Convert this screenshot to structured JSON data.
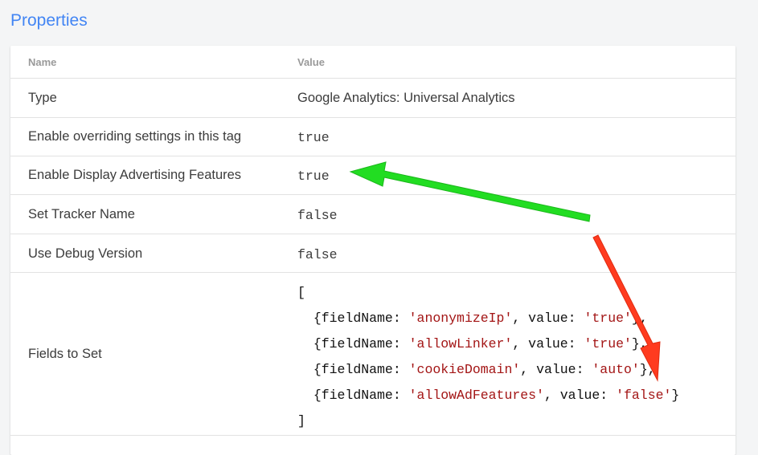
{
  "section": {
    "title": "Properties"
  },
  "table": {
    "headers": {
      "name": "Name",
      "value": "Value"
    },
    "rows": [
      {
        "name": "Type",
        "value": "Google Analytics: Universal Analytics"
      },
      {
        "name": "Enable overriding settings in this tag",
        "value": "true"
      },
      {
        "name": "Enable Display Advertising Features",
        "value": "true"
      },
      {
        "name": "Set Tracker Name",
        "value": "false"
      },
      {
        "name": "Use Debug Version",
        "value": "false"
      }
    ],
    "fields_row": {
      "name": "Fields to Set",
      "open_bracket": "[",
      "close_bracket": "]",
      "key_prefix": "{fieldName: ",
      "value_sep": ", value: ",
      "entry_suffix": "},",
      "last_suffix": "}",
      "entries": [
        {
          "field": "'anonymizeIp'",
          "value": "'true'"
        },
        {
          "field": "'allowLinker'",
          "value": "'true'"
        },
        {
          "field": "'cookieDomain'",
          "value": "'auto'"
        },
        {
          "field": "'allowAdFeatures'",
          "value": "'false'"
        }
      ]
    }
  },
  "colors": {
    "title": "#4285f4",
    "keyword": "#1a1aa6",
    "string": "#a31515",
    "green_arrow": "#22dd22",
    "red_arrow": "#ff3b1f"
  }
}
